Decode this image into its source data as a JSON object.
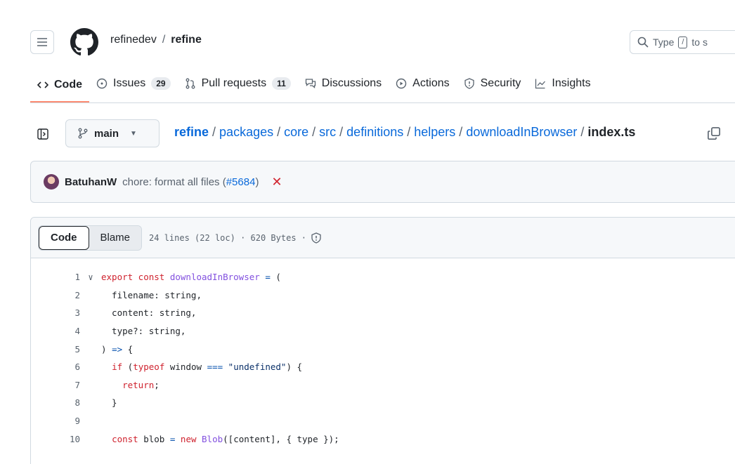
{
  "header": {
    "owner": "refinedev",
    "separator": "/",
    "repo": "refine",
    "search_prefix": "Type",
    "search_key": "/",
    "search_suffix": "to s"
  },
  "tabs": [
    {
      "label": "Code",
      "icon": "code-icon",
      "active": true
    },
    {
      "label": "Issues",
      "icon": "issue-icon",
      "count": "29"
    },
    {
      "label": "Pull requests",
      "icon": "pull-request-icon",
      "count": "11"
    },
    {
      "label": "Discussions",
      "icon": "discussion-icon"
    },
    {
      "label": "Actions",
      "icon": "play-icon"
    },
    {
      "label": "Security",
      "icon": "shield-icon"
    },
    {
      "label": "Insights",
      "icon": "graph-icon"
    }
  ],
  "branch": {
    "name": "main"
  },
  "breadcrumb": {
    "root": "refine",
    "parts": [
      "packages",
      "core",
      "src",
      "definitions",
      "helpers",
      "downloadInBrowser"
    ],
    "file": "index.ts"
  },
  "commit": {
    "author": "BatuhanW",
    "message": "chore: format all files (",
    "pr": "#5684",
    "message_end": ")",
    "status": "✕"
  },
  "file_header": {
    "code_label": "Code",
    "blame_label": "Blame",
    "meta": "24 lines (22 loc) · 620 Bytes ·"
  },
  "code_lines": [
    {
      "n": "1",
      "fold": true
    },
    {
      "n": "2"
    },
    {
      "n": "3"
    },
    {
      "n": "4"
    },
    {
      "n": "5"
    },
    {
      "n": "6"
    },
    {
      "n": "7"
    },
    {
      "n": "8"
    },
    {
      "n": "9"
    },
    {
      "n": "10"
    }
  ],
  "colors": {
    "accent": "#fd8c73",
    "link": "#0969da",
    "keyword": "#cf222e",
    "function": "#8250df"
  }
}
